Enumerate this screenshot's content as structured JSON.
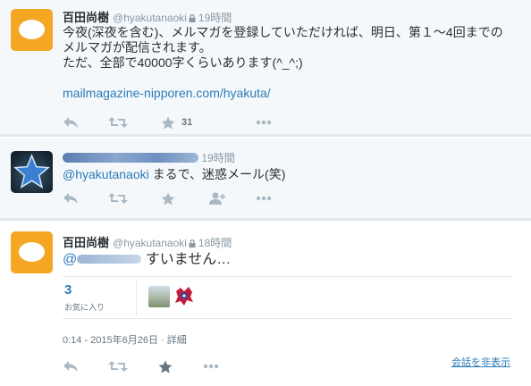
{
  "tweets": [
    {
      "name": "百田尚樹",
      "handle": "@hyakutanaoki",
      "time": "19時間",
      "lines": [
        "今夜(深夜を含む)、メルマガを登録していただければ、明日、第１～4回までの",
        "メルマガが配信されます。",
        "ただ、全部で40000字くらいあります(^_^;)"
      ],
      "link": "mailmagazine-nipporen.com/hyakuta/",
      "favorite_count": "31",
      "avatar": "egg-avatar"
    },
    {
      "time": "19時間",
      "mention": "@hyakutanaoki",
      "text": " まるで、迷惑メール(笑)",
      "avatar": "blue-star-avatar"
    },
    {
      "name": "百田尚樹",
      "handle": "@hyakutanaoki",
      "time": "18時間",
      "mention_prefix": "@",
      "text": " すいません…",
      "favorites_count": "3",
      "favorites_label": "お気に入り",
      "timestamp": "0:14 - 2015年6月26日 · 詳細",
      "hide_conversation": "会話を非表示",
      "avatar": "egg-avatar"
    }
  ],
  "icons": {
    "reply": "reply-icon",
    "retweet": "retweet-icon",
    "favorite": "star-icon",
    "follow": "follow-icon",
    "more": "more-icon",
    "lock": "lock-icon"
  },
  "colors": {
    "link": "#2b7bb9",
    "muted": "#8899a6",
    "icon": "#aab8c2",
    "egg": "#f5a623"
  }
}
